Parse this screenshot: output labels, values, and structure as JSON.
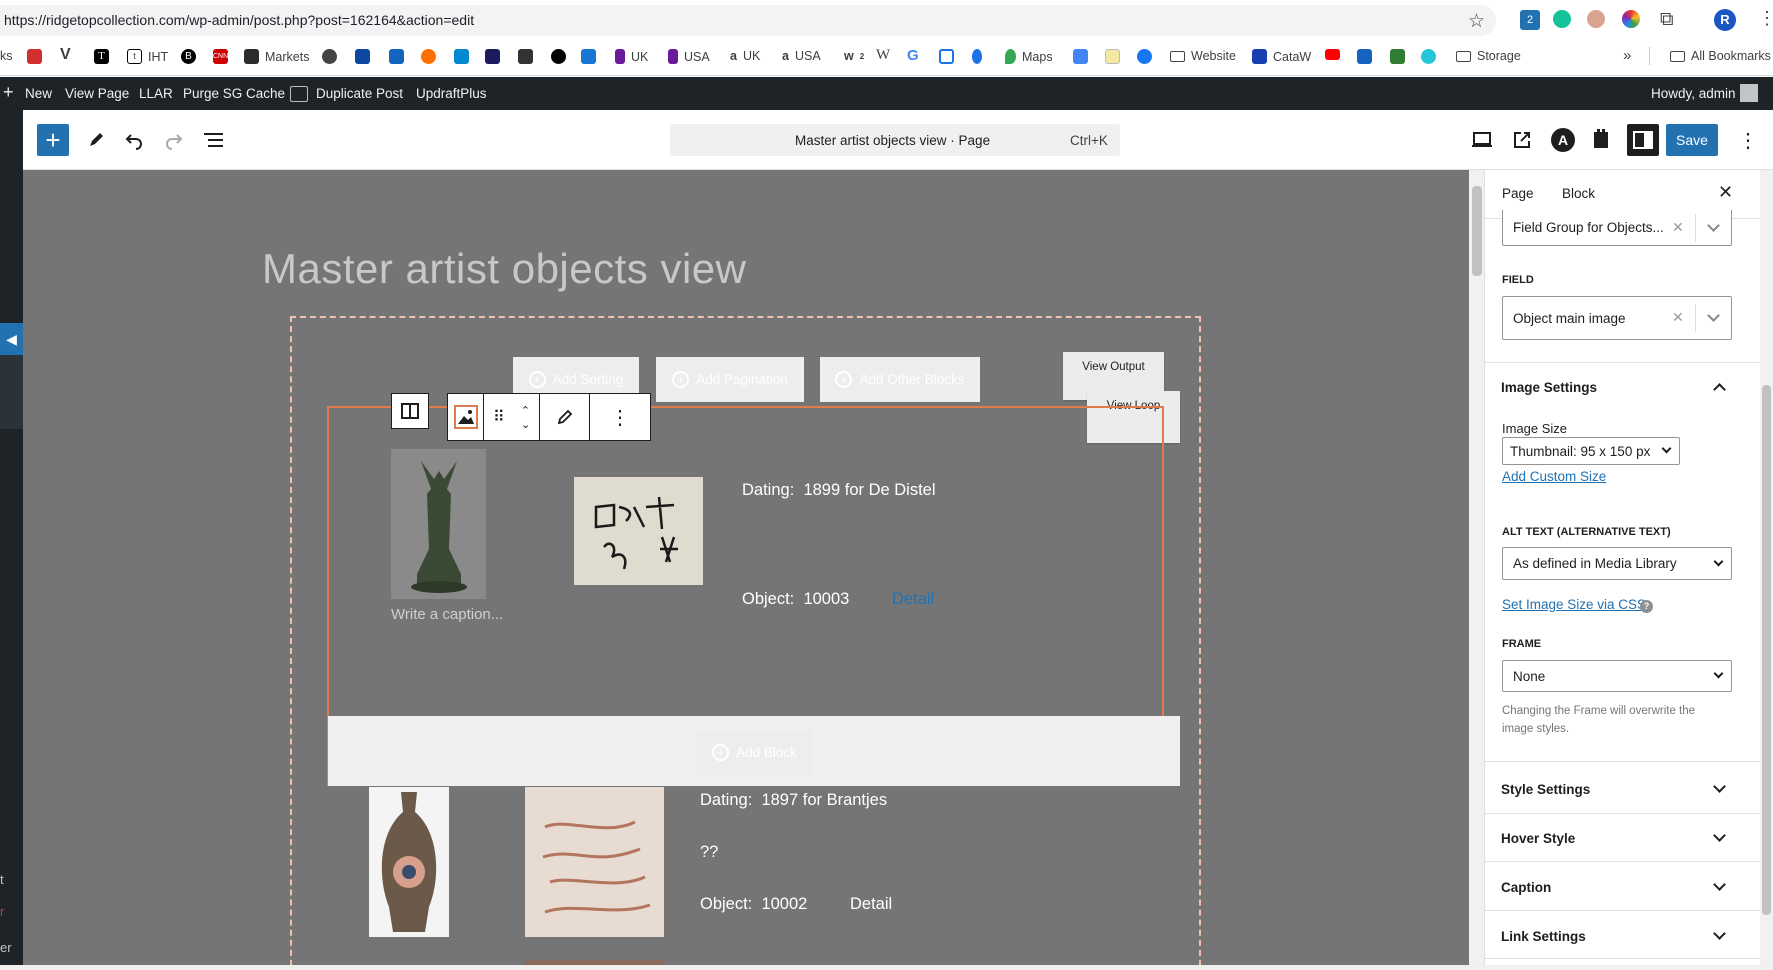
{
  "browser": {
    "url": "https://ridgetopcollection.com/wp-admin/post.php?post=162164&action=edit",
    "ext_badge": "2",
    "profile_initial": "R"
  },
  "bookmarks": {
    "items": [
      "ks",
      "IHT",
      "Markets",
      "UK",
      "USA",
      "UK",
      "USA",
      "Maps",
      "Website",
      "CataW",
      "Storage"
    ],
    "overflow": "»",
    "all": "All Bookmarks"
  },
  "adminbar": {
    "new": "New",
    "view_page": "View Page",
    "llar": "LLAR",
    "purge": "Purge SG Cache",
    "duplicate": "Duplicate Post",
    "updraft": "UpdraftPlus",
    "howdy": "Howdy, admin"
  },
  "editor": {
    "command_title": "Master artist objects view · Page",
    "command_kbd": "Ctrl+K",
    "save": "Save"
  },
  "canvas": {
    "page_title": "Master artist objects view",
    "add_sorting": "Add Sorting",
    "add_pagination": "Add Pagination",
    "add_other": "Add Other Blocks",
    "view_output": "View Output",
    "view_loop": "View Loop",
    "caption_placeholder": "Write a caption...",
    "add_block": "Add Block",
    "items": [
      {
        "dating_label": "Dating:",
        "dating": "1899 for De Distel",
        "object_label": "Object:",
        "object": "10003",
        "detail": "Detail"
      },
      {
        "dating_label": "Dating:",
        "dating": "1897 for Brantjes",
        "extra": "??",
        "object_label": "Object:",
        "object": "10002",
        "detail": "Detail"
      }
    ]
  },
  "left_edge_labels": [
    "t",
    "r",
    "er"
  ],
  "sidebar": {
    "tab_page": "Page",
    "tab_block": "Block",
    "field_group": "Field Group for Objects...",
    "field_label": "FIELD",
    "field_value": "Object main image",
    "image_settings": "Image Settings",
    "image_size_label": "Image Size",
    "image_size_value": "Thumbnail: 95 x 150 px",
    "add_custom_size": "Add Custom Size",
    "alt_label": "ALT TEXT (ALTERNATIVE TEXT)",
    "alt_value": "As defined in Media Library",
    "set_size_css": "Set Image Size via CSS",
    "frame_label": "FRAME",
    "frame_value": "None",
    "frame_help": "Changing the Frame will overwrite the image styles.",
    "style_settings": "Style Settings",
    "hover_style": "Hover Style",
    "caption": "Caption",
    "link_settings": "Link Settings"
  },
  "colors": {
    "admin_bar": "#1d2327",
    "accent": "#2271b1",
    "canvas": "#757575",
    "selection": "#e17a4c"
  }
}
